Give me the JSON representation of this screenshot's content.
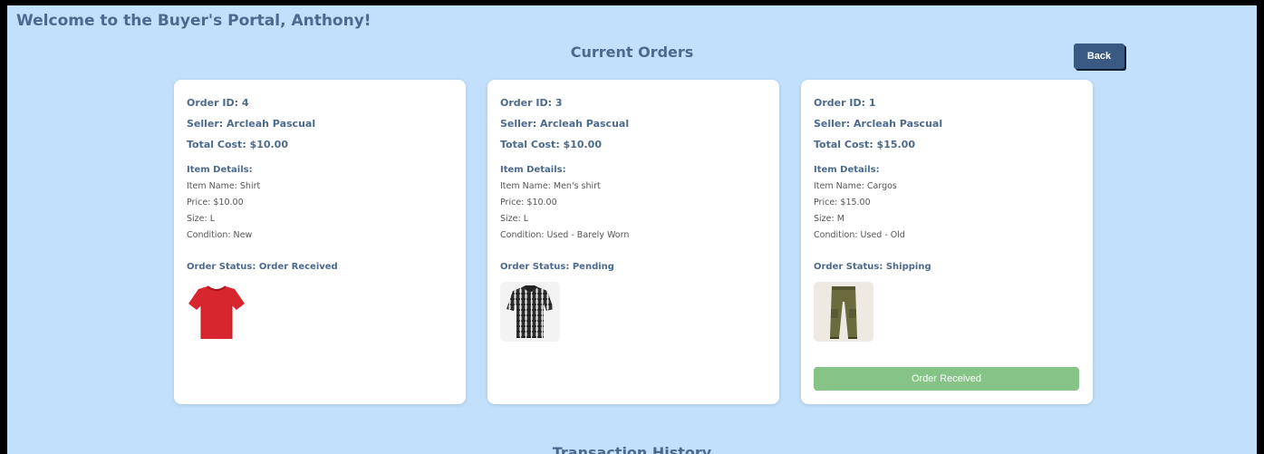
{
  "header": {
    "welcome": "Welcome to the Buyer's Portal, Anthony!"
  },
  "current_orders": {
    "title": "Current Orders",
    "back_label": "Back",
    "orders": [
      {
        "order_id": "Order ID: 4",
        "seller": "Seller: Arcleah Pascual",
        "total": "Total Cost: $10.00",
        "details_label": "Item Details:",
        "item_name": "Item Name: Shirt",
        "price": "Price: $10.00",
        "size": "Size: L",
        "condition": "Condition: New",
        "status": "Order Status: Order Received",
        "image_icon": "red-tshirt-icon"
      },
      {
        "order_id": "Order ID: 3",
        "seller": "Seller: Arcleah Pascual",
        "total": "Total Cost: $10.00",
        "details_label": "Item Details:",
        "item_name": "Item Name: Men's shirt",
        "price": "Price: $10.00",
        "size": "Size: L",
        "condition": "Condition: Used - Barely Worn",
        "status": "Order Status: Pending",
        "image_icon": "plaid-shirt-icon"
      },
      {
        "order_id": "Order ID: 1",
        "seller": "Seller: Arcleah Pascual",
        "total": "Total Cost: $15.00",
        "details_label": "Item Details:",
        "item_name": "Item Name: Cargos",
        "price": "Price: $15.00",
        "size": "Size: M",
        "condition": "Condition: Used - Old",
        "status": "Order Status: Shipping",
        "image_icon": "cargo-pants-icon",
        "action_label": "Order Received"
      }
    ]
  },
  "history": {
    "title": "Transaction History"
  },
  "colors": {
    "background": "#c2dffb",
    "heading": "#4b6a8e",
    "back_button": "#3a5a84",
    "received_button": "#86c387"
  }
}
